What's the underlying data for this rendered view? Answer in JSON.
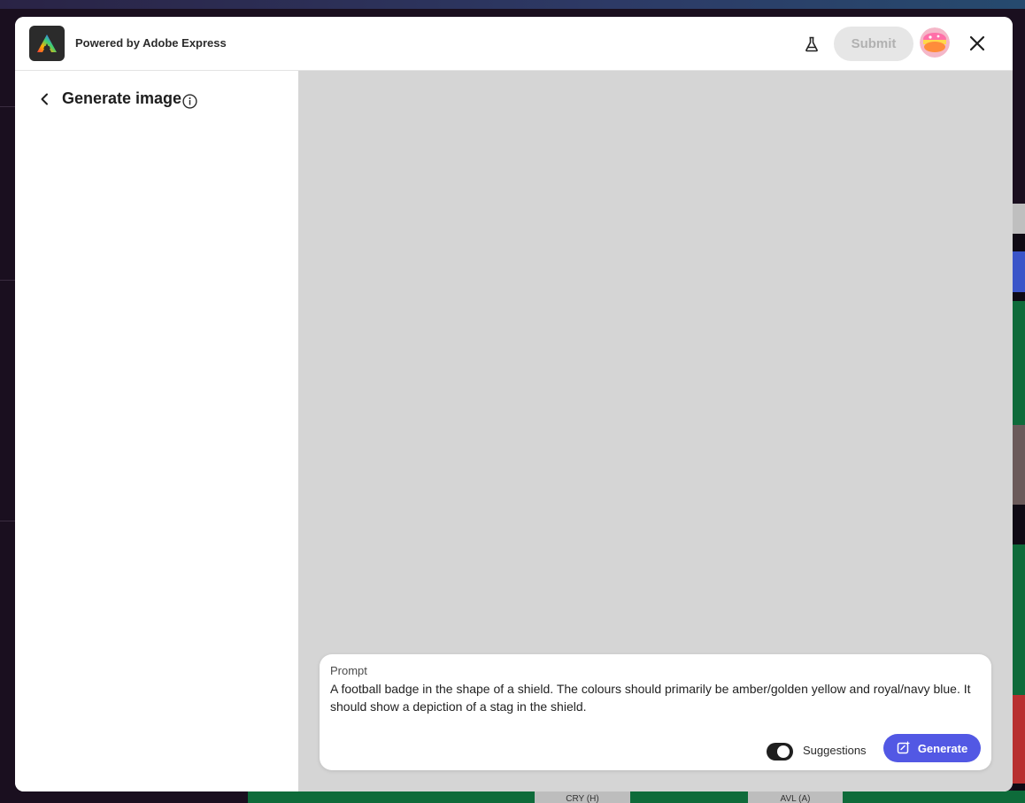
{
  "header": {
    "powered_by": "Powered by Adobe Express",
    "submit_label": "Submit",
    "icons": {
      "logo": "adobe-express-logo",
      "labs": "beaker-icon",
      "avatar": "avatar",
      "close": "close-icon"
    }
  },
  "panel": {
    "title": "Generate image",
    "back_icon": "chevron-left-icon",
    "info_icon": "info-icon"
  },
  "prompt": {
    "label": "Prompt",
    "value": "A football badge in the shape of a shield. The colours should primarily be amber/golden yellow and royal/navy blue. It should show a depiction of a stag in the shield.",
    "suggestions_label": "Suggestions",
    "suggestions_enabled": true,
    "generate_label": "Generate"
  },
  "colors": {
    "accent": "#5258e4",
    "canvas_bg": "#d5d5d5",
    "submit_disabled_bg": "#e6e6e6",
    "submit_disabled_text": "#b1b1b1"
  },
  "background": {
    "chip_1": "CRY (H)",
    "chip_2": "AVL (A)"
  }
}
